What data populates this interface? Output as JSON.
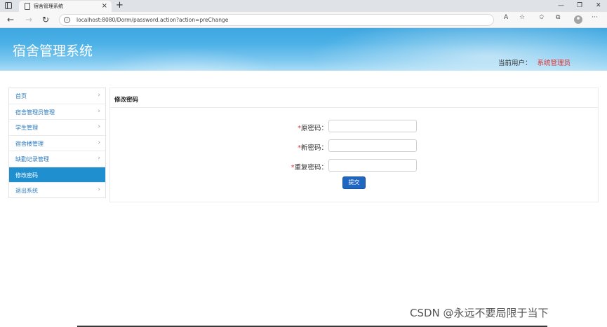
{
  "browser": {
    "tab_title": "宿舍管理系统",
    "tab_close": "×",
    "new_tab": "+",
    "win_min": "—",
    "win_max": "❐",
    "win_close": "✕",
    "back": "←",
    "forward": "→",
    "reload": "↻",
    "info": "i",
    "url": "localhost:8080/Dorm/password.action?action=preChange",
    "read_aloud": "A",
    "favorite": "☆",
    "favorites_list": "✩",
    "collections": "⧉",
    "menu": "···"
  },
  "header": {
    "site_title": "宿舍管理系统",
    "user_label": "当前用户：",
    "user_name": "系统管理员"
  },
  "sidebar": {
    "items": [
      {
        "label": "首页",
        "arrow": "›"
      },
      {
        "label": "宿舍管理员管理",
        "arrow": "›"
      },
      {
        "label": "学生管理",
        "arrow": "›"
      },
      {
        "label": "宿舍楼管理",
        "arrow": "›"
      },
      {
        "label": "缺勤记录管理",
        "arrow": "›"
      },
      {
        "label": "修改密码",
        "arrow": "›"
      },
      {
        "label": "退出系统",
        "arrow": "›"
      }
    ]
  },
  "main": {
    "title": "修改密码",
    "form": {
      "required_mark": "*",
      "old_password_label": "原密码：",
      "new_password_label": "新密码：",
      "repeat_password_label": "重复密码：",
      "submit_label": "提交"
    }
  },
  "watermark": "CSDN @永远不要局限于当下",
  "colors": {
    "banner": "#4ab0e6",
    "active_nav": "#1f8fd0",
    "submit": "#1f66c1",
    "user_name": "#e03030",
    "nav_link": "#2a7bc0"
  }
}
